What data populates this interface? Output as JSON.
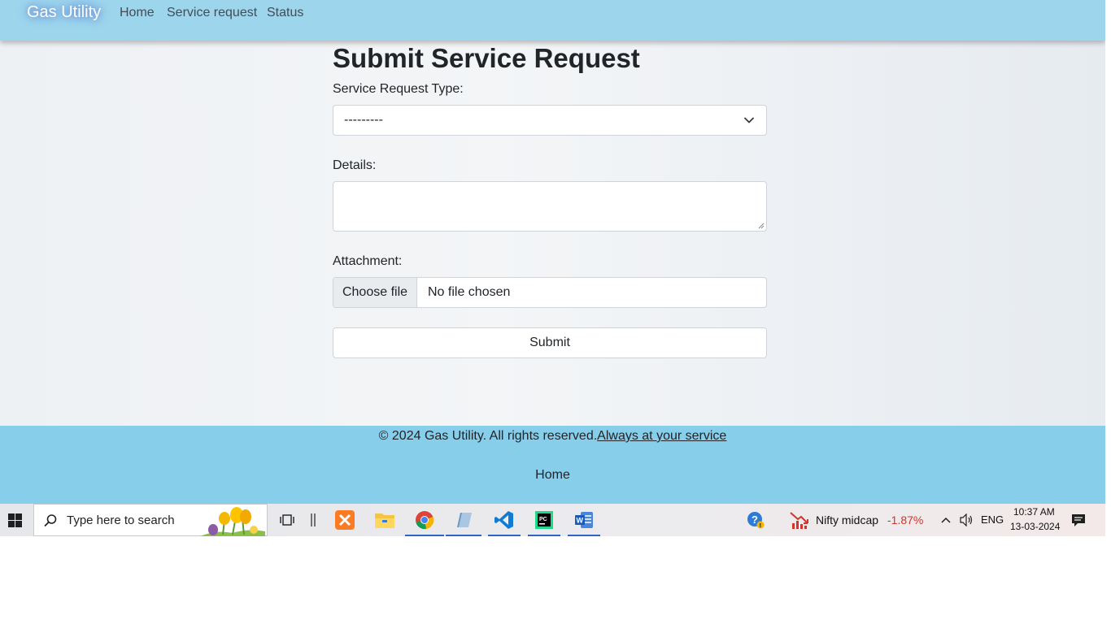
{
  "navbar": {
    "brand": "Gas Utility",
    "links": [
      "Home",
      "Service request",
      "Status"
    ]
  },
  "form": {
    "title": "Submit Service Request",
    "type_label": "Service Request Type:",
    "type_value": "---------",
    "details_label": "Details:",
    "details_value": "",
    "attachment_label": "Attachment:",
    "choose_file_label": "Choose file",
    "file_status": "No file chosen",
    "submit_label": "Submit"
  },
  "footer": {
    "copyright": "© 2024 Gas Utility. All rights reserved.",
    "tagline_link": "Always at your service",
    "home_link": "Home"
  },
  "taskbar": {
    "search_placeholder": "Type here to search",
    "pinned_apps": [
      "task-view",
      "xampp",
      "file-explorer",
      "chrome",
      "notepad",
      "vscode",
      "pycharm",
      "word"
    ],
    "news_label": "Nifty midcap",
    "news_change": "-1.87%",
    "language": "ENG",
    "time": "10:37 AM",
    "date": "13-03-2024"
  },
  "colors": {
    "navbar": "#9dd5ec",
    "footer": "#87ceeb",
    "negative": "#d0342c"
  }
}
